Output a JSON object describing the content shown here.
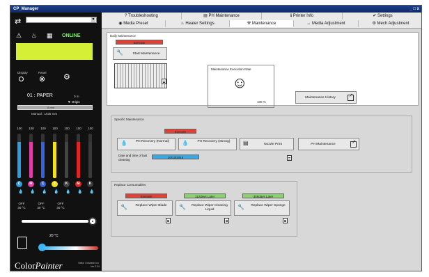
{
  "window": {
    "title": "CP_Manager",
    "controls": "_ □ x"
  },
  "left_panel": {
    "device_select_value": "",
    "status": {
      "online": "ONLINE"
    },
    "display_label": "Display",
    "panel_label": "Panel",
    "paper_label": "01 : PAPER",
    "paper_position": "0 m",
    "origin_label": "▼ Origin",
    "paper_bar_label": "0 mm",
    "manual_label": "Manual : 1635 mm",
    "inks": [
      {
        "pct": "100",
        "color": "#2f9be0",
        "letter": "C",
        "level": 0.82
      },
      {
        "pct": "100",
        "color": "#e23aa6",
        "letter": "M",
        "level": 0.82
      },
      {
        "pct": "100",
        "color": "#3560e0",
        "letter": "C",
        "level": 0.82
      },
      {
        "pct": "100",
        "color": "#f2e21b",
        "letter": "Y",
        "level": 0.82
      },
      {
        "pct": "100",
        "color": "#444444",
        "letter": "K",
        "level": 0.82
      },
      {
        "pct": "100",
        "color": "#e02424",
        "letter": "M",
        "level": 0.82
      },
      {
        "pct": "100",
        "color": "#3a3a3a",
        "letter": "K",
        "level": 0.82
      }
    ],
    "heaters": [
      {
        "state": "OFF",
        "temp": "30 °C"
      },
      {
        "state": "OFF",
        "temp": "30 °C"
      },
      {
        "state": "OFF",
        "temp": "30 °C"
      }
    ],
    "room_temp": "20 °C",
    "logo_main": "Color",
    "logo_sub": "Painter",
    "logo_vendor": "Seiko I Infotech Inc.",
    "logo_version": "Ver 2.34"
  },
  "tabs": {
    "row1": [
      "Troubleshooting",
      "PH Maintenance",
      "Printer Info",
      "Settings"
    ],
    "row2": [
      "Media Preset",
      "Heater Settings",
      "Maintenance",
      "Media Adjustment",
      "Mech Adjustment"
    ],
    "active": "Maintenance"
  },
  "daily": {
    "title": "Daily Maintenance",
    "status": "Execute",
    "start_button": "Start Maintenance",
    "rate_title": "Maintenance Execution Rate",
    "rate_value": "100 %",
    "history_button": "Maintenance History"
  },
  "specific": {
    "title": "Specific Maintenance",
    "status": "Execute",
    "ph_normal": "PH Recovery (Normal)",
    "ph_strong": "PH Recovery (Strong)",
    "date_label": "Date and time of last cleaning",
    "date_value": "10/13/2015",
    "nozzle_print": "Nozzle Print",
    "ph_maintenance": "PH Maintenance"
  },
  "consumables": {
    "title": "Replace Consumables",
    "items": [
      {
        "status": "Execute",
        "status_class": "red",
        "label": "Replace Wiper Blade"
      },
      {
        "status": "112days Later",
        "status_class": "green",
        "label": "Replace Wiper Cleaning Liquid"
      },
      {
        "status": "359days Later",
        "status_class": "green",
        "label": "Replace Wiper Sponge"
      }
    ]
  }
}
